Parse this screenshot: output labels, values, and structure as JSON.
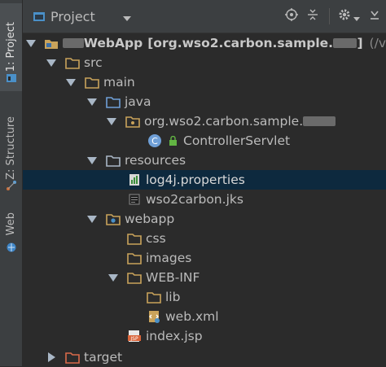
{
  "window": {
    "view_title": "Project"
  },
  "left_strip": {
    "tabs": [
      {
        "label": "1: Project"
      },
      {
        "label": "Z: Structure"
      },
      {
        "label": "Web"
      }
    ]
  },
  "tree": {
    "root": {
      "name_prefix": "",
      "name": "WebApp",
      "module": "[org.wso2.carbon.sample.",
      "module_suffix": "]",
      "path_hint": "(/v"
    },
    "src": "src",
    "main": "main",
    "java": "java",
    "package": "org.wso2.carbon.sample.",
    "class_badge": "C",
    "servlet": "ControllerServlet",
    "resources": "resources",
    "log4j": "log4j.properties",
    "jks": "wso2carbon.jks",
    "webapp": "webapp",
    "css": "css",
    "images": "images",
    "webinf": "WEB-INF",
    "lib": "lib",
    "webxml": "web.xml",
    "indexjsp": "index.jsp",
    "jsp_badge": "JSP",
    "target": "target"
  },
  "colors": {
    "background": "#2b2b2b",
    "panel": "#3c3f41",
    "selection": "#0d293e",
    "folder": "#c9a35b",
    "source_folder": "#6fa0d8",
    "excluded_folder": "#d96a4a",
    "text": "#bbbbbb"
  }
}
